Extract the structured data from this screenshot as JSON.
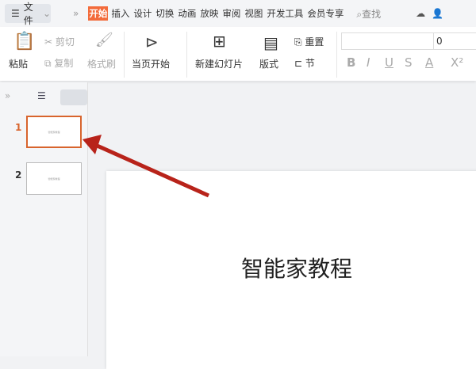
{
  "topbar": {
    "file_label": "文件",
    "tabs": [
      "开始",
      "插入",
      "设计",
      "切换",
      "动画",
      "放映",
      "审阅",
      "视图",
      "开发工具",
      "会员专享"
    ],
    "active_tab": "开始",
    "search_label": "查找"
  },
  "ribbon": {
    "paste": "粘贴",
    "cut": "剪切",
    "copy": "复制",
    "format_painter": "格式刷",
    "play_from_current": "当页开始",
    "new_slide": "新建幻灯片",
    "layout": "版式",
    "reset": "重置",
    "section": "节",
    "font_size": "0",
    "format_buttons": [
      "B",
      "I",
      "U",
      "S",
      "A",
      "X²"
    ]
  },
  "slides_panel": {
    "slides": [
      {
        "number": "1",
        "thumb_text": "智能家教程"
      },
      {
        "number": "2",
        "thumb_text": "智能家教程"
      }
    ]
  },
  "slide": {
    "title": "智能家教程"
  },
  "colors": {
    "accent": "#f36b3b",
    "arrow": "#b8231a",
    "selected_border": "#d8642d"
  }
}
